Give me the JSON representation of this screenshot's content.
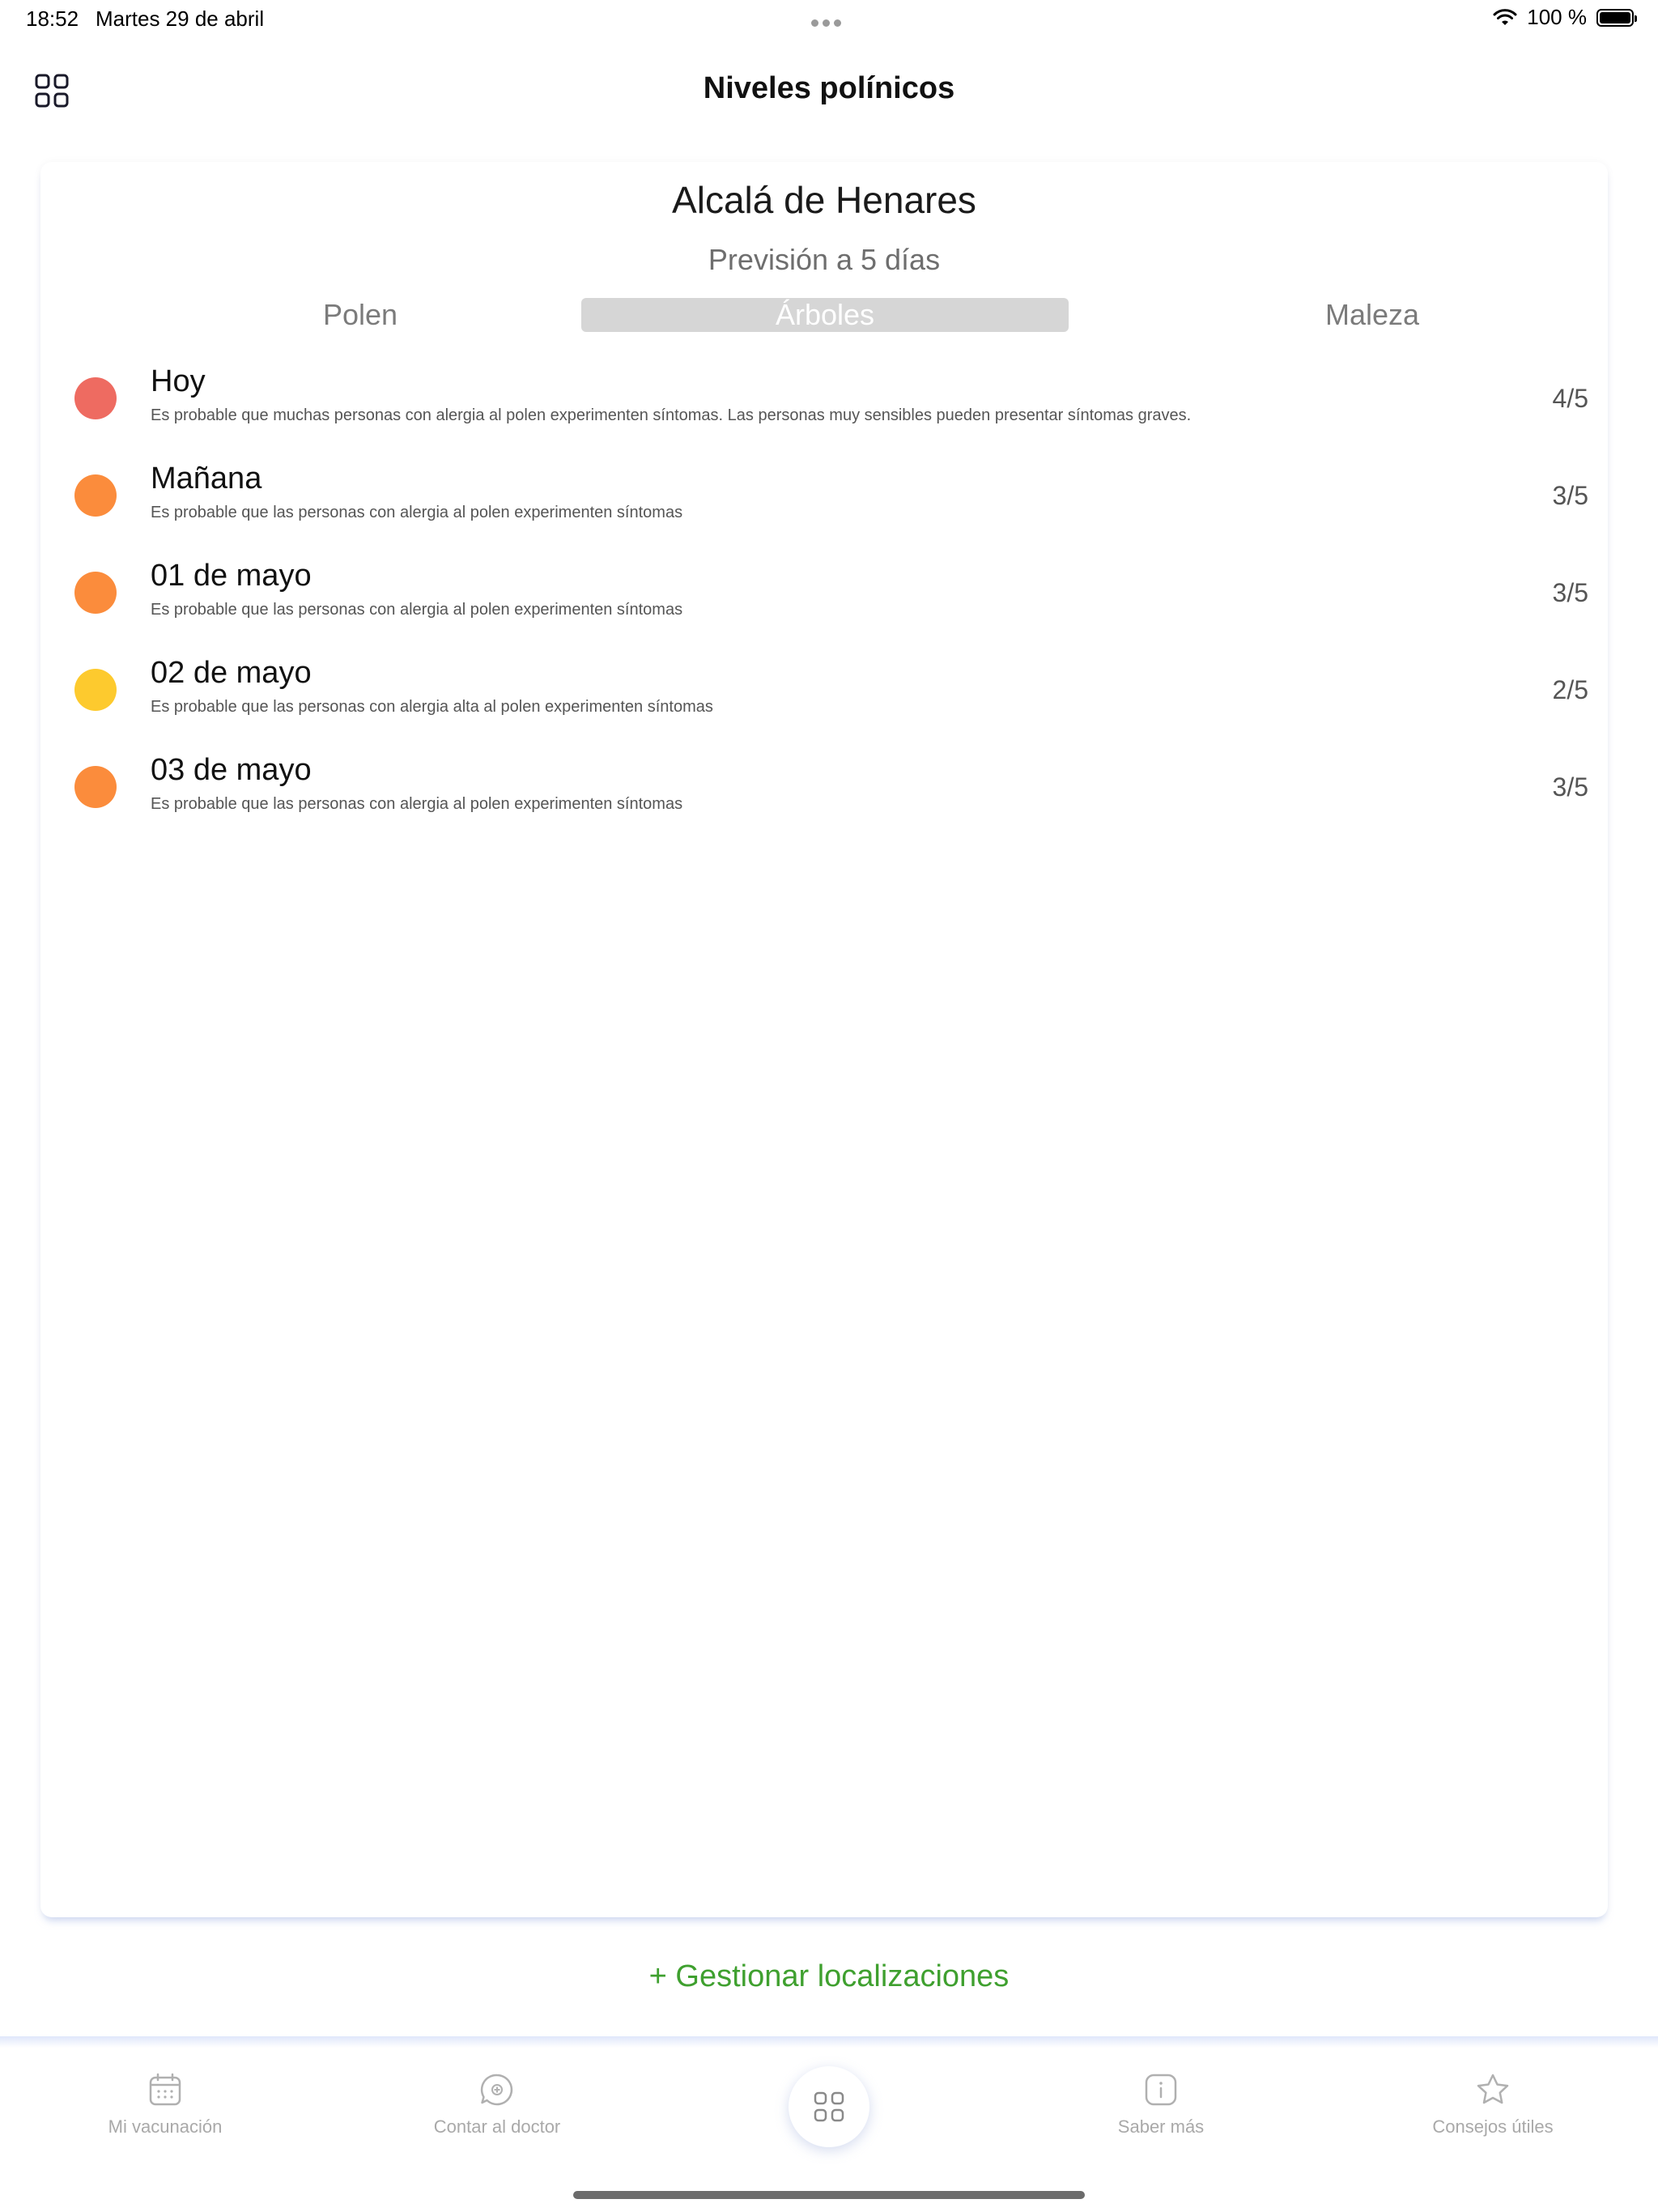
{
  "status_bar": {
    "time": "18:52",
    "date": "Martes 29 de abril",
    "battery_text": "100 %"
  },
  "header": {
    "title": "Niveles polínicos",
    "menu_icon": "grid-icon"
  },
  "card": {
    "location": "Alcalá de Henares",
    "forecast_label": "Previsión a 5 días",
    "tabs": [
      {
        "label": "Polen",
        "selected": false
      },
      {
        "label": "Árboles",
        "selected": true
      },
      {
        "label": "Maleza",
        "selected": false
      }
    ],
    "rows": [
      {
        "title": "Hoy",
        "description": "Es probable que muchas personas con alergia al polen experimenten síntomas. Las personas muy sensibles pueden presentar síntomas graves.",
        "score": "4/5",
        "color": "#ee6b61"
      },
      {
        "title": "Mañana",
        "description": "Es probable que las personas con alergia al polen experimenten síntomas",
        "score": "3/5",
        "color": "#fb8c3c"
      },
      {
        "title": "01 de mayo",
        "description": "Es probable que las personas con alergia al polen experimenten síntomas",
        "score": "3/5",
        "color": "#fb8c3c"
      },
      {
        "title": "02 de mayo",
        "description": "Es probable que las personas con alergia alta al polen experimenten síntomas",
        "score": "2/5",
        "color": "#fdca2e"
      },
      {
        "title": "03 de mayo",
        "description": "Es probable que las personas con alergia al polen experimenten síntomas",
        "score": "3/5",
        "color": "#fb8c3c"
      }
    ]
  },
  "manage_locations": "+ Gestionar localizaciones",
  "tabbar": {
    "items": [
      {
        "label": "Mi vacunación",
        "icon": "calendar-icon"
      },
      {
        "label": "Contar al doctor",
        "icon": "chat-plus-icon"
      },
      {
        "label": "",
        "icon": "grid-icon"
      },
      {
        "label": "Saber más",
        "icon": "info-icon"
      },
      {
        "label": "Consejos útiles",
        "icon": "star-icon"
      }
    ]
  },
  "colors": {
    "accent_green": "#3fa02f",
    "selected_tab_bg": "#d6d6d6",
    "level_4": "#ee6b61",
    "level_3": "#fb8c3c",
    "level_2": "#fdca2e"
  }
}
